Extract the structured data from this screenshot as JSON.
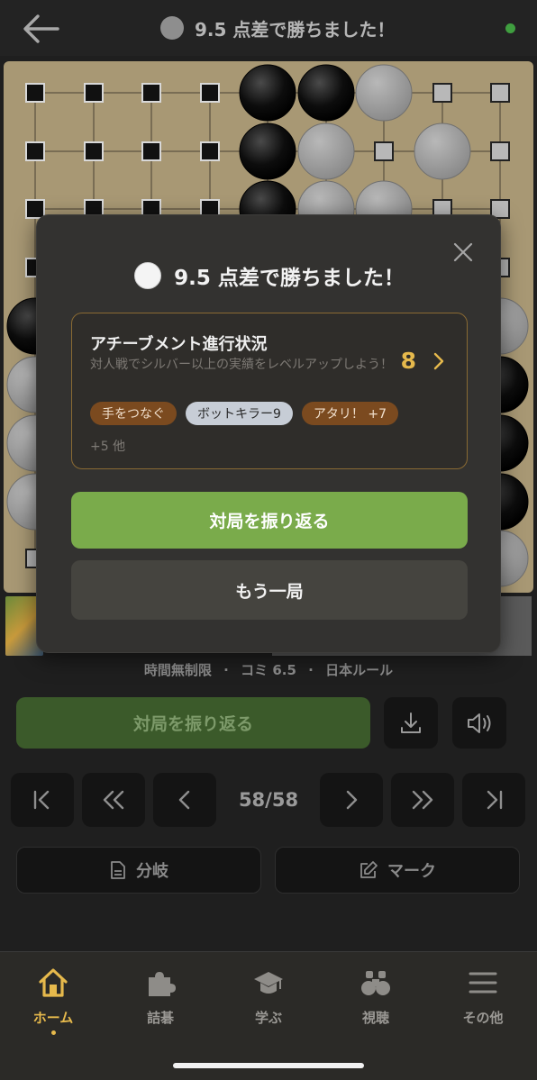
{
  "header": {
    "title": "9.5 点差で勝ちました！",
    "back_icon": "back-arrow-icon",
    "connection_status_color": "#3f9e3f"
  },
  "game": {
    "info": [
      "時間無制限",
      "コミ 6.5",
      "日本ルール"
    ],
    "separator": "·",
    "move_counter": "58/58",
    "review_label": "対局を振り返る",
    "branch_label": "分岐",
    "mark_label": "マーク"
  },
  "modal": {
    "title": "9.5 点差で勝ちました！",
    "achievement": {
      "heading": "アチーブメント進行状況",
      "description": "対人戦でシルバー以上の実績をレベルアップしよう！",
      "count": "8",
      "tags": [
        "手をつなぐ",
        "ボットキラー9",
        "アタリ！ +7"
      ],
      "more": "+5 他"
    },
    "review_button": "対局を振り返る",
    "again_button": "もう一局"
  },
  "tabbar": {
    "items": [
      {
        "label": "ホーム",
        "icon": "home-icon",
        "active": true
      },
      {
        "label": "詰碁",
        "icon": "puzzle-icon",
        "active": false
      },
      {
        "label": "学ぶ",
        "icon": "graduation-cap-icon",
        "active": false
      },
      {
        "label": "視聴",
        "icon": "binoculars-icon",
        "active": false
      },
      {
        "label": "その他",
        "icon": "menu-icon",
        "active": false
      }
    ]
  },
  "colors": {
    "accent": "#e6b94c",
    "primary_button": "#7aab4b",
    "board": "#a89874"
  }
}
